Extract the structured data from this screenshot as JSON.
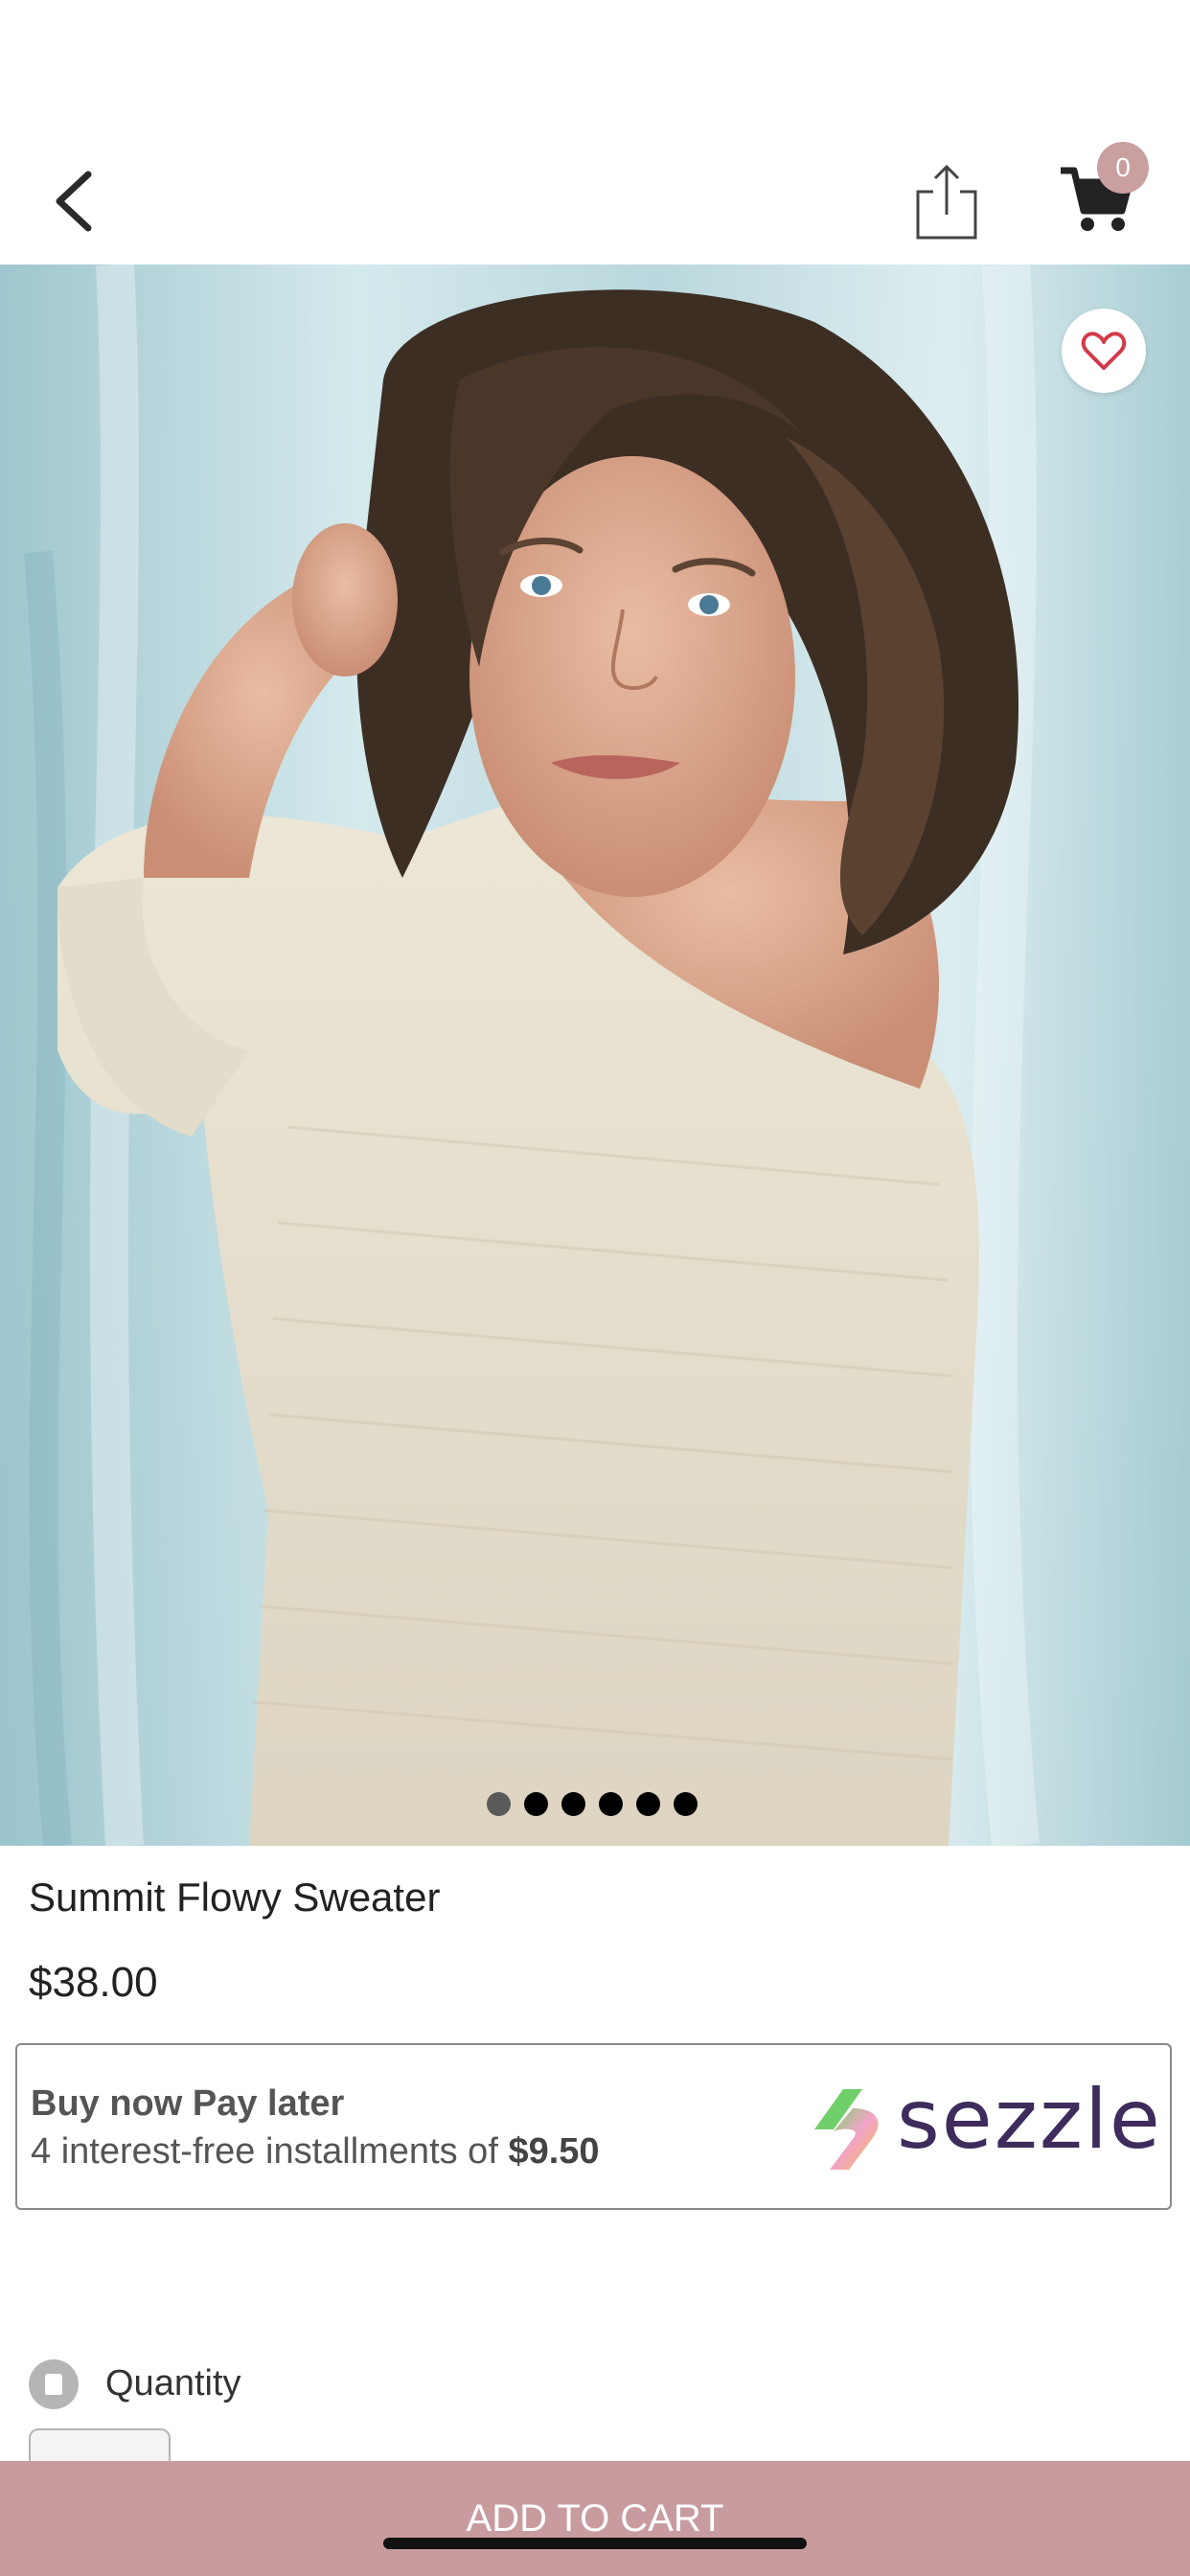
{
  "header": {
    "cart_count": "0",
    "icons": [
      "chevron-left-icon",
      "share-icon",
      "cart-icon"
    ]
  },
  "product": {
    "title": "Summit Flowy Sweater",
    "price": "$38.00",
    "image_dots_total": 6,
    "image_dots_active": 1
  },
  "sezzle": {
    "headline": "Buy now Pay later",
    "installments_prefix": "4 interest-free installments of",
    "installment_amount": "$9.50",
    "brand": "sezzle",
    "brand_color": "#3d2c5c"
  },
  "quantity": {
    "label": "Quantity"
  },
  "cta": {
    "add_to_cart": "ADD TO CART",
    "color": "#c89b9f"
  }
}
